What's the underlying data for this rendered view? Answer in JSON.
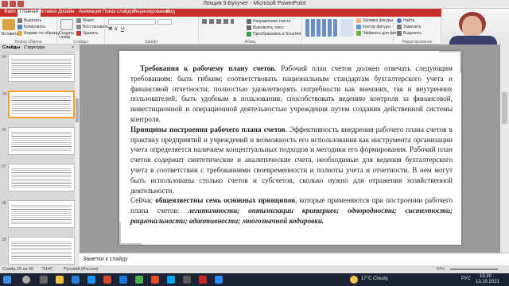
{
  "window": {
    "title": "Лекция 5-Бухучет - Microsoft PowerPoint"
  },
  "ribbon": {
    "tabs": [
      "Файл",
      "Главная",
      "Вставка",
      "Дизайн",
      "Анимация",
      "Показ слайдов",
      "Рецензирование",
      "Вид"
    ],
    "active_tab": "Главная",
    "clipboard": {
      "cut": "Вырезать",
      "copy": "Копировать",
      "paste_format": "Формат по образцу",
      "paste": "Вставить",
      "label": "Буфер обмена"
    },
    "slides": {
      "new_slide": "Создать слайд",
      "layout": "Макет",
      "reset": "Восстановить",
      "delete": "Удалить",
      "label": "Слайды"
    },
    "font_label": "Шрифт",
    "paragraph_label": "Абзац",
    "drawing": {
      "shape_fill": "Заливка фигуры",
      "shape_outline": "Контур фигуры",
      "shape_effects": "Эффекты для фигур",
      "text_direction": "Направление текста",
      "align_text": "Выровнять текст",
      "smartart": "Преобразовать в SmartArt"
    },
    "editing": {
      "find": "Найти",
      "replace": "Заменить",
      "select": "Выделить",
      "label": "Редактирование"
    }
  },
  "panel": {
    "tab_slides": "Слайды",
    "tab_outline": "Структура",
    "slide_numbers": [
      "24",
      "25",
      "26",
      "27",
      "28",
      "29"
    ]
  },
  "slide": {
    "p1_bold": "Требования к рабочему плану счетов.",
    "p1_text": " Рабочий план счетов должен отвечать следующим требованиям: быть гибким; соответствовать национальным стандартам бухгалтерского учета и финансовой отчетности; полностью удовлетворять потребности как внешних, так и внутренних пользователей; быть удобным в пользовании; способствовать ведению контроля за финансовой, инвестиционной и операционной деятельностью учреждения путем создания действенной системы контроля.",
    "p2_bold": "Принципы построения рабочего плана счетов",
    "p2_text": ". Эффективность внедрения рабочего плана счетов в практику предприятий и учреждений и возможность его использования как инструмента организации учета определяется наличием концептуальных подходов и методики его формирования. Рабочий план счетов содержит синтетические и аналитические счета, необходимые для ведения бухгалтерского учета в соответствии с требованиями своевременности и полноты учета и отчетности. В нем могут быть использованы столько счетов и субсчетов, сколько нужно для отражения хозяйственной деятельности.",
    "p3_intro": " Сейчас ",
    "p3_bold": "общеизвестны семь основных принципов",
    "p3_text": ", которые применяются при построении рабочего плана счетов: ",
    "p3_principles": "легитимности; оптимизации критериев; однородности; системности; рациональности; адаптивности; многозначной кодировки."
  },
  "notes": {
    "placeholder": "Заметки к слайду"
  },
  "status": {
    "slide_counter": "Слайд 25 из 45",
    "theme": "\"Shift\"",
    "language": "Русский (Россия)",
    "zoom": "70%"
  },
  "taskbar": {
    "weather": "17°C Cloudy",
    "language": "РУС",
    "time": "15:20",
    "date": "13.10.2021"
  },
  "colors": {
    "ribbon_accent": "#c7302c",
    "selection": "#f0a030",
    "taskbar": "#1c2433"
  }
}
